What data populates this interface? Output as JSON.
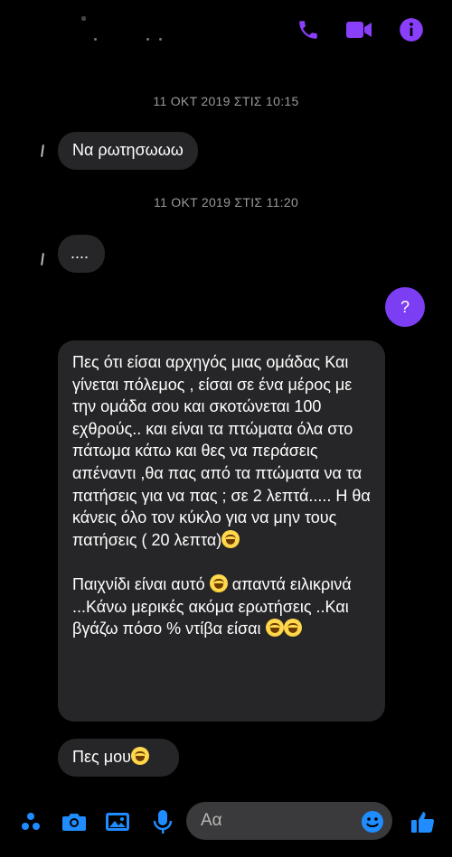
{
  "header": {
    "icons": [
      "phone-icon",
      "video-camera-icon",
      "info-icon"
    ],
    "accent": "#8a3ffc"
  },
  "messages": {
    "timestamp1": "11 ΟΚΤ 2019 ΣΤΙΣ 10:15",
    "msg1": "Να ρωτησωωω",
    "timestamp2": "11 ΟΚΤ 2019 ΣΤΙΣ 11:20",
    "msg2": "....",
    "sent1": "?",
    "long_p1": "Πες ότι είσαι αρχηγός μιας ομάδας Και γίνεται πόλεμος , είσαι σε ένα μέρος με την ομάδα σου και σκοτώνεται 100 εχθρούς.. και είναι τα πτώματα όλα στο πάτωμα κάτω και θες να περάσεις απέναντι ,θα πας από τα πτώματα να τα πατήσεις  για να πας ; σε 2 λεπτά..... Η θα κάνεις όλο τον κύκλο για να μην τους πατήσεις ( 20 λεπτα)",
    "long_p2a": "Παιχνίδι είναι αυτό",
    "long_p2b": " απαντά ειλικρινά ...Κάνω μερικές ακόμα ερωτήσεις ..Και βγάζω πόσο % ντίβα είσαι ",
    "msg3": "Πες μου"
  },
  "composer": {
    "placeholder": "Αα",
    "icons": [
      "more-icon",
      "camera-icon",
      "gallery-icon",
      "microphone-icon",
      "emoji-icon",
      "thumbs-up-icon"
    ]
  },
  "colors": {
    "background": "#000000",
    "bubble_received": "#262628",
    "bubble_sent": "#7b3ef3",
    "timestamp": "#9a9a9a"
  }
}
